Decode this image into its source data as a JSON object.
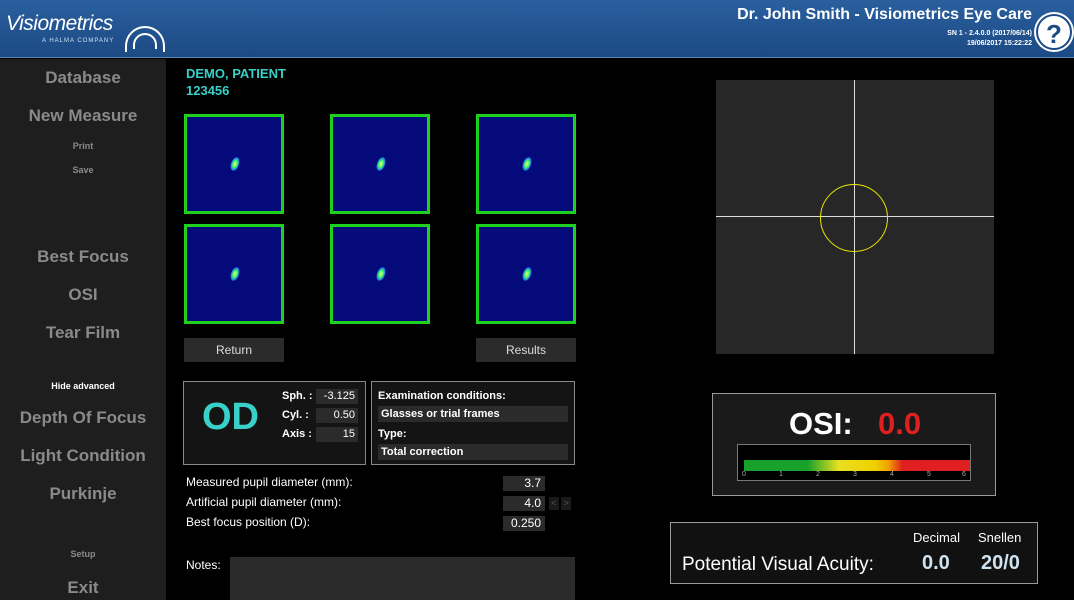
{
  "header": {
    "logo_text": "Visiometrics",
    "logo_sub": "A HALMA COMPANY",
    "clinic_title": "Dr. John Smith - Visiometrics Eye Care",
    "version": "SN 1 - 2.4.0.0 (2017/06/14)",
    "datetime": "19/06/2017 15:22:22",
    "help_label": "?"
  },
  "sidebar": {
    "database": "Database",
    "new_measure": "New Measure",
    "print": "Print",
    "save": "Save",
    "best_focus": "Best Focus",
    "osi": "OSI",
    "tear_film": "Tear Film",
    "hide_advanced": "Hide advanced",
    "depth_of_focus": "Depth Of Focus",
    "light_condition": "Light Condition",
    "purkinje": "Purkinje",
    "setup": "Setup",
    "exit": "Exit"
  },
  "patient": {
    "name": "DEMO, PATIENT",
    "id": "123456"
  },
  "buttons": {
    "return": "Return",
    "results": "Results"
  },
  "refraction": {
    "eye": "OD",
    "sph_label": "Sph. :",
    "sph_value": "-3.125",
    "cyl_label": "Cyl. :",
    "cyl_value": "0.50",
    "axis_label": "Axis :",
    "axis_value": "15"
  },
  "exam": {
    "title": "Examination conditions:",
    "condition": "Glasses or trial frames",
    "type_label": "Type:",
    "type_value": "Total correction"
  },
  "measurements": {
    "measured_pupil_label": "Measured pupil diameter (mm):",
    "measured_pupil_value": "3.7",
    "artificial_pupil_label": "Artificial pupil diameter (mm):",
    "artificial_pupil_value": "4.0",
    "best_focus_label": "Best focus position (D):",
    "best_focus_value": "0.250",
    "arrow_left": "<",
    "arrow_right": ">"
  },
  "notes": {
    "label": "Notes:",
    "value": ""
  },
  "osi": {
    "label": "OSI:",
    "value": "0.0",
    "scale_ticks": [
      "0",
      "1",
      "2",
      "3",
      "4",
      "5",
      "6"
    ],
    "colors": {
      "good": "#17a02a",
      "medium": "#e8e020",
      "bad": "#e02020"
    }
  },
  "visual_acuity": {
    "label": "Potential Visual Acuity:",
    "decimal_header": "Decimal",
    "snellen_header": "Snellen",
    "decimal_value": "0.0",
    "snellen_value": "20/0"
  },
  "colors": {
    "header_bg": "#1c4a84",
    "patient_text": "#38d0c8",
    "thumb_border": "#1fd11f",
    "crosshair_circle": "#e8e800"
  }
}
